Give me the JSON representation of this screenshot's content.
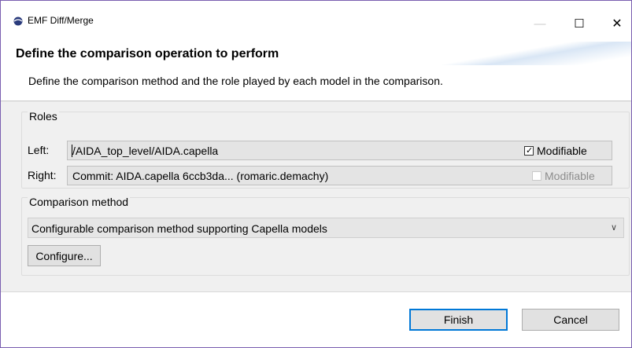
{
  "window": {
    "title": "EMF Diff/Merge",
    "minimize": "—",
    "maximize": "☐",
    "close": "✕",
    "icon": "emf-diffmerge-icon"
  },
  "header": {
    "title": "Define the comparison operation to perform",
    "description": "Define the comparison method and the role played by each model in the comparison."
  },
  "roles": {
    "group_label": "Roles",
    "left": {
      "label": "Left:",
      "value": "/AIDA_top_level/AIDA.capella",
      "modifiable_label": "Modifiable",
      "modifiable_checked": true,
      "modifiable_enabled": true
    },
    "right": {
      "label": "Right:",
      "value": "Commit: AIDA.capella 6ccb3da... (romaric.demachy)",
      "modifiable_label": "Modifiable",
      "modifiable_checked": false,
      "modifiable_enabled": false
    }
  },
  "comparison_method": {
    "group_label": "Comparison method",
    "selected": "Configurable comparison method supporting Capella models",
    "configure_label": "Configure..."
  },
  "buttons": {
    "finish": "Finish",
    "cancel": "Cancel"
  },
  "colors": {
    "window_border": "#7a5fb0",
    "default_button_border": "#0078d7",
    "panel_background": "#f0f0f0"
  }
}
